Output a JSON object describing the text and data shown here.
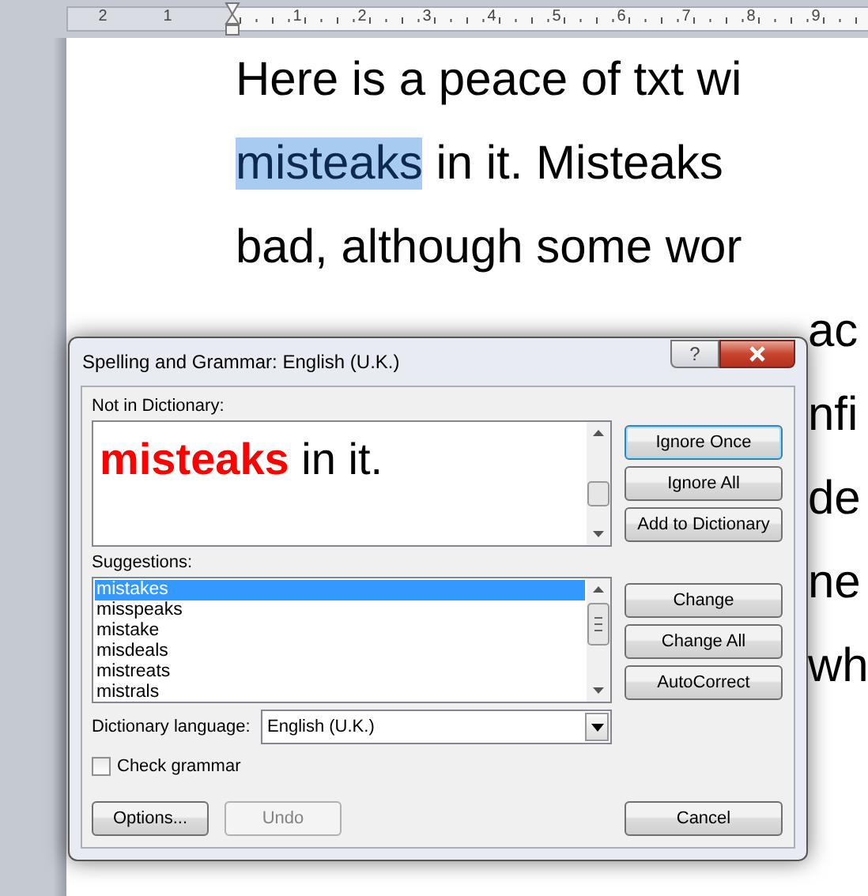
{
  "ruler": {
    "labels": [
      "2",
      "1",
      "1",
      "2",
      "3",
      "4",
      "5",
      "6",
      "7",
      "8",
      "9"
    ]
  },
  "document": {
    "lines": [
      {
        "kind": "full",
        "segments": [
          {
            "text": "Here is a peace of txt wi",
            "selected": false
          }
        ]
      },
      {
        "kind": "full",
        "segments": [
          {
            "text": "misteaks",
            "selected": true
          },
          {
            "text": " in it. Misteaks",
            "selected": false
          }
        ]
      },
      {
        "kind": "full",
        "segments": [
          {
            "text": "bad, although some wor",
            "selected": false
          }
        ]
      },
      {
        "kind": "fragment",
        "segments": [
          {
            "text": "ac",
            "selected": false
          }
        ]
      },
      {
        "kind": "fragment",
        "segments": [
          {
            "text": "nfi",
            "selected": false
          }
        ]
      },
      {
        "kind": "fragment",
        "segments": [
          {
            "text": "de",
            "selected": false
          }
        ]
      },
      {
        "kind": "fragment",
        "segments": [
          {
            "text": "ne",
            "selected": false
          }
        ]
      },
      {
        "kind": "fragment",
        "segments": [
          {
            "text": "wh",
            "selected": false
          }
        ]
      }
    ]
  },
  "dialog": {
    "title": "Spelling and Grammar: English (U.K.)",
    "help_button": "?",
    "not_in_dictionary": {
      "label": "Not in Dictionary:",
      "error_word": "misteaks",
      "after": " in it."
    },
    "suggestions": {
      "label": "Suggestions:",
      "items": [
        {
          "text": "mistakes",
          "selected": true
        },
        {
          "text": "misspeaks",
          "selected": false
        },
        {
          "text": "mistake",
          "selected": false
        },
        {
          "text": "misdeals",
          "selected": false
        },
        {
          "text": "mistreats",
          "selected": false
        },
        {
          "text": "mistrals",
          "selected": false
        }
      ]
    },
    "language": {
      "label": "Dictionary language:",
      "value": "English (U.K.)"
    },
    "check_grammar": {
      "label": "Check grammar",
      "checked": false
    },
    "buttons": {
      "top": [
        {
          "label": "Ignore Once",
          "focused": true,
          "disabled": false
        },
        {
          "label": "Ignore All",
          "focused": false,
          "disabled": false
        },
        {
          "label": "Add to Dictionary",
          "focused": false,
          "disabled": false
        }
      ],
      "middle": [
        {
          "label": "Change",
          "focused": false,
          "disabled": false
        },
        {
          "label": "Change All",
          "focused": false,
          "disabled": false
        },
        {
          "label": "AutoCorrect",
          "focused": false,
          "disabled": false
        }
      ],
      "bottom_left": [
        {
          "label": "Options...",
          "focused": false,
          "disabled": false
        },
        {
          "label": "Undo",
          "focused": false,
          "disabled": true
        }
      ],
      "bottom_right": [
        {
          "label": "Cancel",
          "focused": false,
          "disabled": false
        }
      ]
    }
  }
}
